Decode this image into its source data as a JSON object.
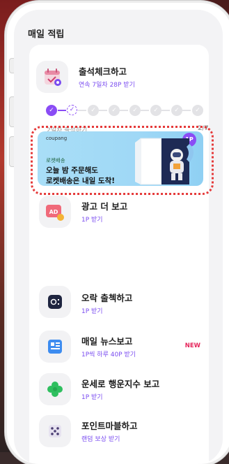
{
  "page": {
    "title": "매일 적립"
  },
  "checkin": {
    "title": "출석체크하고",
    "subtitle": "연속 7일차 28P 받기",
    "progress_label": "2일차 출석하기",
    "progress_count": "2/7",
    "days_completed": 1,
    "days_total": 7,
    "current_day": 2
  },
  "ad": {
    "brand": "coupang",
    "kicker": "로켓배송",
    "line1": "오늘 밤 주문해도",
    "line2": "로켓배송은 내일 도착!",
    "point_badge": "1P"
  },
  "items": [
    {
      "title": "광고 더 보고",
      "subtitle": "1P 받기",
      "icon": "ad-icon",
      "badge": ""
    },
    {
      "title": "오락 출첵하고",
      "subtitle": "1P 받기",
      "icon": "game-icon",
      "badge": ""
    },
    {
      "title": "매일 뉴스보고",
      "subtitle": "1P씩 하루 40P 받기",
      "icon": "news-icon",
      "badge": "NEW"
    },
    {
      "title": "운세로 행운지수 보고",
      "subtitle": "1P 받기",
      "icon": "clover-icon",
      "badge": ""
    },
    {
      "title": "포인트마블하고",
      "subtitle": "랜덤 보상 받기",
      "icon": "dice-icon",
      "badge": ""
    }
  ],
  "colors": {
    "accent": "#8a4cf5",
    "new_badge": "#e5245a",
    "highlight_outline": "#e53a3a"
  }
}
